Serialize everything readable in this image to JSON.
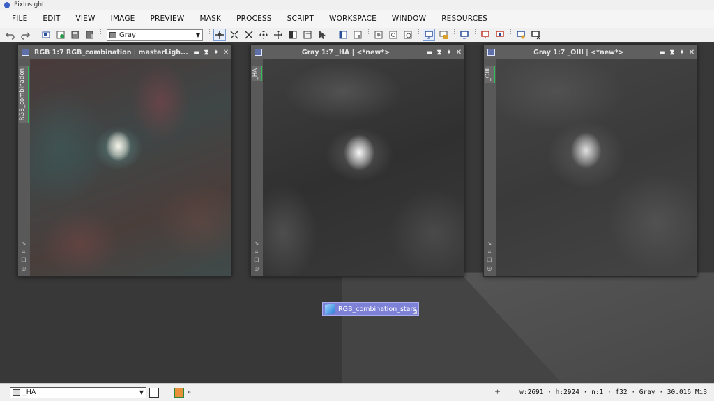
{
  "app": {
    "title": "PixInsight"
  },
  "menu": [
    "FILE",
    "EDIT",
    "VIEW",
    "IMAGE",
    "PREVIEW",
    "MASK",
    "PROCESS",
    "SCRIPT",
    "WORKSPACE",
    "WINDOW",
    "RESOURCES"
  ],
  "toolbar": {
    "mode_select": {
      "value": "Gray"
    }
  },
  "windows": [
    {
      "title": "RGB 1:7 RGB_combination | masterLigh...",
      "tab": "RGB_combination"
    },
    {
      "title": "Gray 1:7 _HA | <*new*>",
      "tab": "_HA"
    },
    {
      "title": "Gray 1:7 _OIII | <*new*>",
      "tab": "_OIII"
    }
  ],
  "workspace_icon": {
    "label": "RGB_combination_stars"
  },
  "statusbar": {
    "view_select": "_HA",
    "more": "»",
    "info": "w:2691 · h:2924 · n:1 · f32 · Gray · 30.016 MiB"
  }
}
